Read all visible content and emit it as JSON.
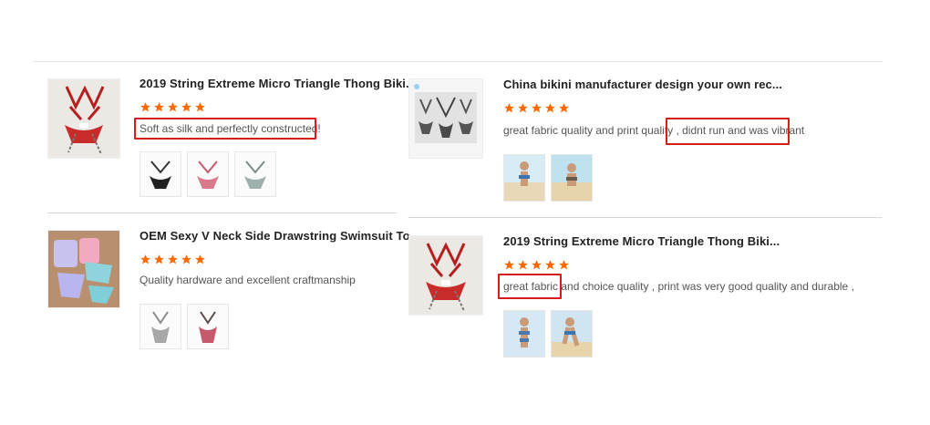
{
  "reviews": [
    {
      "title": "2019 String Extreme Micro Triangle Thong Biki...",
      "rating": 5,
      "review_text": "Soft as silk and perfectly constructed!",
      "photo_count": 3
    },
    {
      "title": "OEM Sexy V Neck Side Drawstring Swimsuit To...",
      "rating": 5,
      "review_text": "Quality hardware and excellent craftmanship",
      "photo_count": 2
    },
    {
      "title": "China bikini manufacturer design your own rec...",
      "rating": 5,
      "review_text_before": "great fabric quality and print quality ,",
      "review_text_highlight": "didnt run and was vibrant",
      "photo_count": 2
    },
    {
      "title": "2019 String Extreme Micro Triangle Thong Biki...",
      "rating": 5,
      "review_text_highlight": "great fabric",
      "review_text_after": "and choice quality , print was very good quality and durable ,",
      "photo_count": 2
    }
  ],
  "colors": {
    "star": "#ff6a00",
    "highlight_box": "#d71c1c",
    "title": "#222222",
    "review_text": "#555555"
  }
}
